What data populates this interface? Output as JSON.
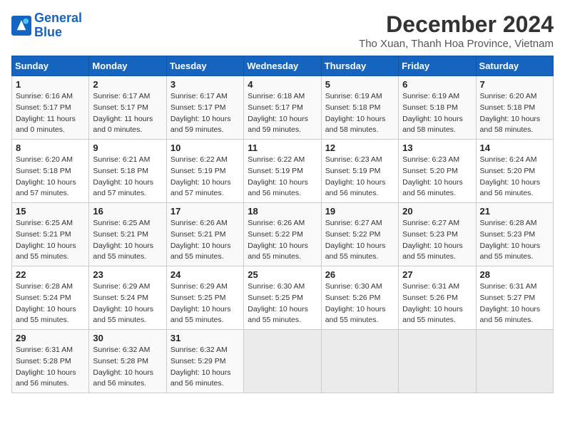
{
  "header": {
    "logo_line1": "General",
    "logo_line2": "Blue",
    "month": "December 2024",
    "location": "Tho Xuan, Thanh Hoa Province, Vietnam"
  },
  "days_of_week": [
    "Sunday",
    "Monday",
    "Tuesday",
    "Wednesday",
    "Thursday",
    "Friday",
    "Saturday"
  ],
  "weeks": [
    [
      {
        "day": "1",
        "rise": "6:16 AM",
        "set": "5:17 PM",
        "hours": "11 hours and 0 minutes."
      },
      {
        "day": "2",
        "rise": "6:17 AM",
        "set": "5:17 PM",
        "hours": "11 hours and 0 minutes."
      },
      {
        "day": "3",
        "rise": "6:17 AM",
        "set": "5:17 PM",
        "hours": "10 hours and 59 minutes."
      },
      {
        "day": "4",
        "rise": "6:18 AM",
        "set": "5:17 PM",
        "hours": "10 hours and 59 minutes."
      },
      {
        "day": "5",
        "rise": "6:19 AM",
        "set": "5:18 PM",
        "hours": "10 hours and 58 minutes."
      },
      {
        "day": "6",
        "rise": "6:19 AM",
        "set": "5:18 PM",
        "hours": "10 hours and 58 minutes."
      },
      {
        "day": "7",
        "rise": "6:20 AM",
        "set": "5:18 PM",
        "hours": "10 hours and 58 minutes."
      }
    ],
    [
      {
        "day": "8",
        "rise": "6:20 AM",
        "set": "5:18 PM",
        "hours": "10 hours and 57 minutes."
      },
      {
        "day": "9",
        "rise": "6:21 AM",
        "set": "5:18 PM",
        "hours": "10 hours and 57 minutes."
      },
      {
        "day": "10",
        "rise": "6:22 AM",
        "set": "5:19 PM",
        "hours": "10 hours and 57 minutes."
      },
      {
        "day": "11",
        "rise": "6:22 AM",
        "set": "5:19 PM",
        "hours": "10 hours and 56 minutes."
      },
      {
        "day": "12",
        "rise": "6:23 AM",
        "set": "5:19 PM",
        "hours": "10 hours and 56 minutes."
      },
      {
        "day": "13",
        "rise": "6:23 AM",
        "set": "5:20 PM",
        "hours": "10 hours and 56 minutes."
      },
      {
        "day": "14",
        "rise": "6:24 AM",
        "set": "5:20 PM",
        "hours": "10 hours and 56 minutes."
      }
    ],
    [
      {
        "day": "15",
        "rise": "6:25 AM",
        "set": "5:21 PM",
        "hours": "10 hours and 55 minutes."
      },
      {
        "day": "16",
        "rise": "6:25 AM",
        "set": "5:21 PM",
        "hours": "10 hours and 55 minutes."
      },
      {
        "day": "17",
        "rise": "6:26 AM",
        "set": "5:21 PM",
        "hours": "10 hours and 55 minutes."
      },
      {
        "day": "18",
        "rise": "6:26 AM",
        "set": "5:22 PM",
        "hours": "10 hours and 55 minutes."
      },
      {
        "day": "19",
        "rise": "6:27 AM",
        "set": "5:22 PM",
        "hours": "10 hours and 55 minutes."
      },
      {
        "day": "20",
        "rise": "6:27 AM",
        "set": "5:23 PM",
        "hours": "10 hours and 55 minutes."
      },
      {
        "day": "21",
        "rise": "6:28 AM",
        "set": "5:23 PM",
        "hours": "10 hours and 55 minutes."
      }
    ],
    [
      {
        "day": "22",
        "rise": "6:28 AM",
        "set": "5:24 PM",
        "hours": "10 hours and 55 minutes."
      },
      {
        "day": "23",
        "rise": "6:29 AM",
        "set": "5:24 PM",
        "hours": "10 hours and 55 minutes."
      },
      {
        "day": "24",
        "rise": "6:29 AM",
        "set": "5:25 PM",
        "hours": "10 hours and 55 minutes."
      },
      {
        "day": "25",
        "rise": "6:30 AM",
        "set": "5:25 PM",
        "hours": "10 hours and 55 minutes."
      },
      {
        "day": "26",
        "rise": "6:30 AM",
        "set": "5:26 PM",
        "hours": "10 hours and 55 minutes."
      },
      {
        "day": "27",
        "rise": "6:31 AM",
        "set": "5:26 PM",
        "hours": "10 hours and 55 minutes."
      },
      {
        "day": "28",
        "rise": "6:31 AM",
        "set": "5:27 PM",
        "hours": "10 hours and 56 minutes."
      }
    ],
    [
      {
        "day": "29",
        "rise": "6:31 AM",
        "set": "5:28 PM",
        "hours": "10 hours and 56 minutes."
      },
      {
        "day": "30",
        "rise": "6:32 AM",
        "set": "5:28 PM",
        "hours": "10 hours and 56 minutes."
      },
      {
        "day": "31",
        "rise": "6:32 AM",
        "set": "5:29 PM",
        "hours": "10 hours and 56 minutes."
      },
      null,
      null,
      null,
      null
    ]
  ],
  "labels": {
    "sunrise": "Sunrise:",
    "sunset": "Sunset:",
    "daylight": "Daylight:"
  }
}
